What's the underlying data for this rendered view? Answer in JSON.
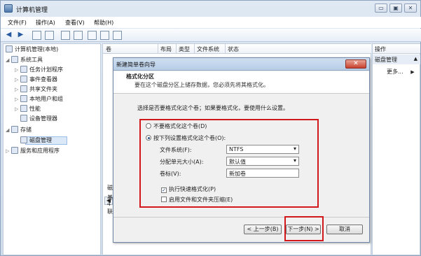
{
  "window": {
    "title": "计算机管理",
    "min_label": "▭",
    "max_label": "▣",
    "close_label": "✕"
  },
  "menu": [
    "文件(F)",
    "操作(A)",
    "查看(V)",
    "帮助(H)"
  ],
  "toolbar": {
    "back": "◀",
    "forward": "▶"
  },
  "tree": {
    "root": "计算机管理(本地)",
    "items": [
      {
        "label": "系统工具"
      },
      {
        "label": "任务计划程序"
      },
      {
        "label": "事件查看器"
      },
      {
        "label": "共享文件夹"
      },
      {
        "label": "本地用户和组"
      },
      {
        "label": "性能"
      },
      {
        "label": "设备管理器"
      },
      {
        "label": "存储"
      },
      {
        "label": "磁盘管理"
      },
      {
        "label": "服务和应用程序"
      }
    ]
  },
  "center": {
    "headers": [
      "卷",
      "布局",
      "类型",
      "文件系统",
      "状态"
    ],
    "scroll_left": "◀",
    "side_text": [
      "磁",
      "基",
      "4",
      "联"
    ]
  },
  "actions": {
    "header": "操作",
    "section": "磁盘管理",
    "more": "更多..."
  },
  "dialog": {
    "title": "新建简单卷向导",
    "close": "✕",
    "heading": "格式化分区",
    "subtitle": "要在这个磁盘分区上储存数据，您必须先将其格式化。",
    "prompt": "选择是否要格式化这个卷；如果要格式化，要使用什么设置。",
    "option_no_format": "不要格式化这个卷(D)",
    "option_format": "按下列设置格式化这个卷(O):",
    "fs_label": "文件系统(F):",
    "fs_value": "NTFS",
    "alloc_label": "分配单元大小(A):",
    "alloc_value": "默认值",
    "vol_label": "卷标(V):",
    "vol_value": "新加卷",
    "quick_format": "执行快速格式化(P)",
    "compression": "启用文件和文件夹压缩(E)",
    "back": "< 上一步(B)",
    "next": "下一步(N) >",
    "cancel": "取消"
  }
}
